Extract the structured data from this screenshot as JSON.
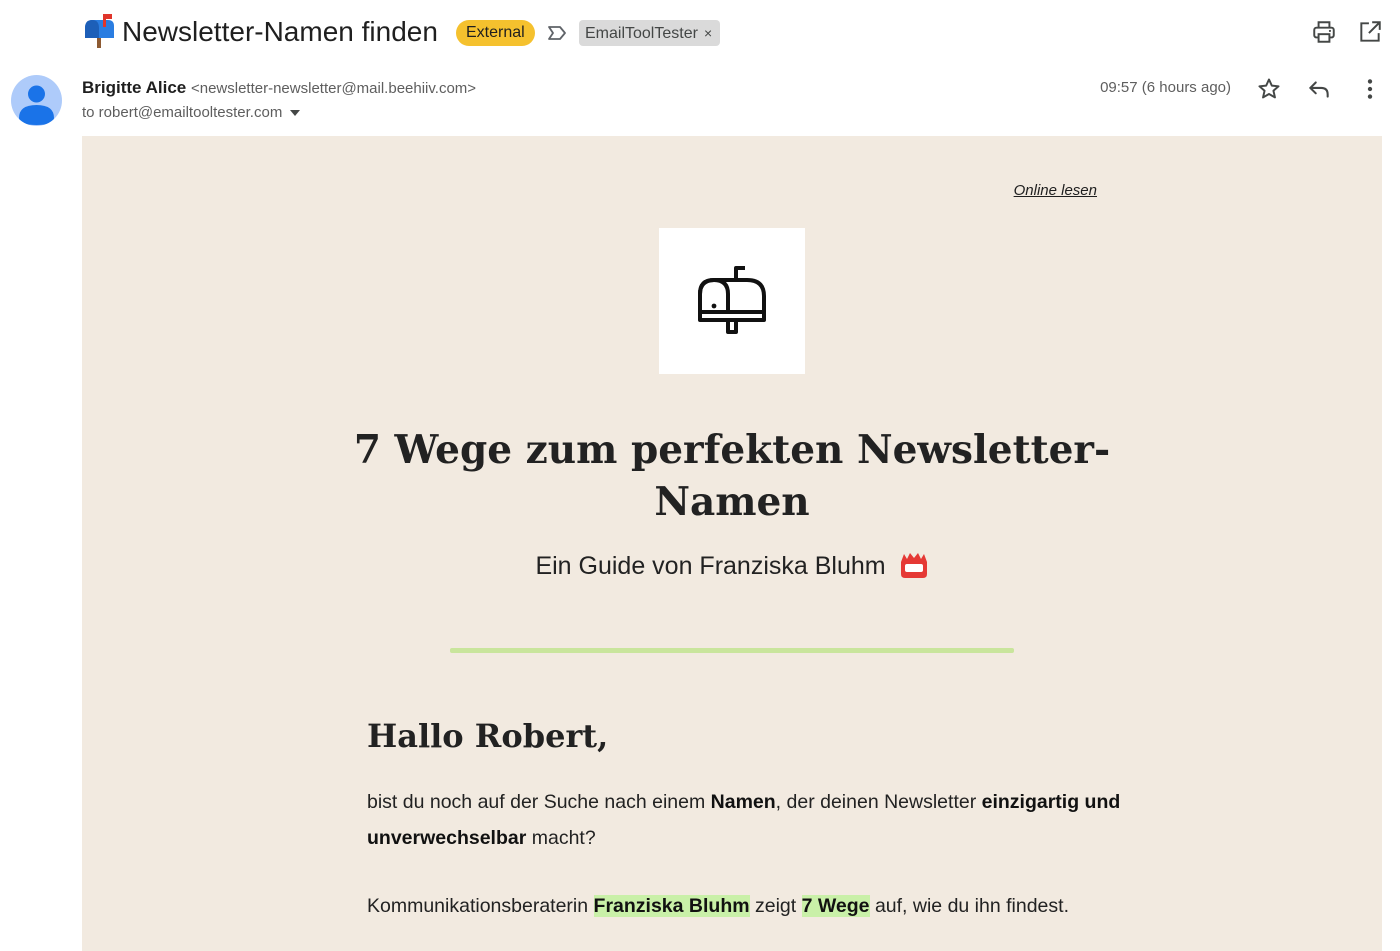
{
  "subject": {
    "emoji": "mailbox-with-raised-flag",
    "title": "Newsletter-Namen finden",
    "external_badge": "External",
    "label_chip": "EmailToolTester",
    "label_remove": "×"
  },
  "sender": {
    "name": "Brigitte Alice",
    "email": "<newsletter-newsletter@mail.beehiiv.com>",
    "recipient": "to robert@emailtooltester.com",
    "timestamp": "09:57 (6 hours ago)"
  },
  "email": {
    "online_link": "Online lesen",
    "headline": "7 Wege zum perfekten Newsletter-Namen",
    "subheadline": "Ein Guide von Franziska Bluhm",
    "subheadline_emoji": "name-badge-emoji",
    "greeting": "Hallo Robert,",
    "paragraph1": {
      "t1": "bist du noch auf der Suche nach einem ",
      "b1": "Namen",
      "t2": ", der deinen Newsletter ",
      "b2": "einzigartig und unverwechselbar",
      "t3": " macht?"
    },
    "paragraph2": {
      "t1": "Kommunikationsberaterin ",
      "h1": "Franziska Bluhm",
      "t2": " zeigt ",
      "h2": "7 Wege",
      "t3": " auf, wie du ihn findest."
    }
  },
  "colors": {
    "email_background": "#f2eae0",
    "external_badge": "#f5c12e",
    "divider": "#c9e59c",
    "highlight": "#c9f0a8",
    "avatar": "#aecbfa"
  }
}
